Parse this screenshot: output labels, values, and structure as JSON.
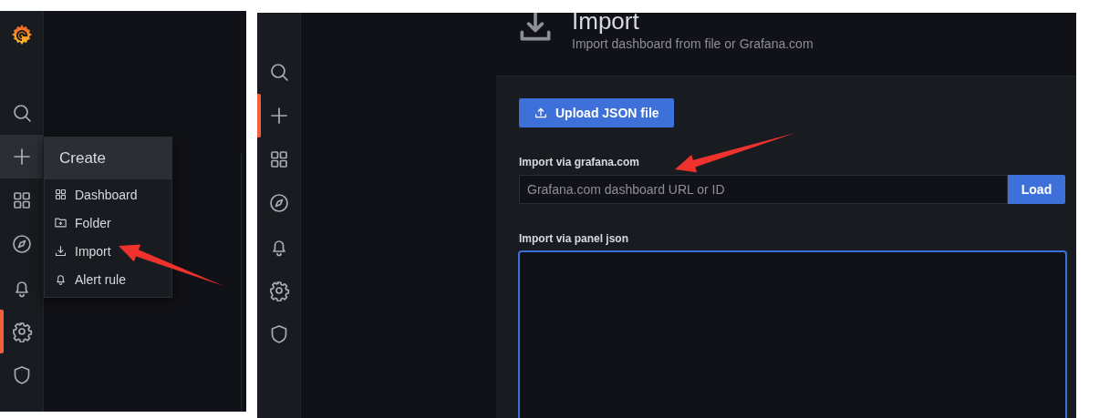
{
  "left_screenshot": {
    "sidebar": {
      "items": [
        {
          "selected": false,
          "hovered": false
        },
        {
          "selected": false,
          "hovered": true
        },
        {
          "selected": false,
          "hovered": false
        },
        {
          "selected": false,
          "hovered": false
        },
        {
          "selected": false,
          "hovered": false
        },
        {
          "selected": true,
          "hovered": false
        },
        {
          "selected": false,
          "hovered": false
        }
      ]
    },
    "create_menu": {
      "title": "Create",
      "items": [
        {
          "label": "Dashboard"
        },
        {
          "label": "Folder"
        },
        {
          "label": "Import"
        },
        {
          "label": "Alert rule"
        }
      ]
    }
  },
  "right_screenshot": {
    "sidebar": {
      "items": [
        {
          "selected": false,
          "hovered": false
        },
        {
          "selected": true,
          "hovered": false
        },
        {
          "selected": false,
          "hovered": false
        },
        {
          "selected": false,
          "hovered": false
        },
        {
          "selected": false,
          "hovered": false
        },
        {
          "selected": false,
          "hovered": false
        },
        {
          "selected": false,
          "hovered": false
        }
      ]
    },
    "header": {
      "title": "Import",
      "subtitle": "Import dashboard from file or Grafana.com"
    },
    "upload_button": "Upload JSON file",
    "grafana_com": {
      "label": "Import via grafana.com",
      "placeholder": "Grafana.com dashboard URL or ID",
      "button": "Load"
    },
    "panel_json": {
      "label": "Import via panel json",
      "focused": true
    }
  }
}
